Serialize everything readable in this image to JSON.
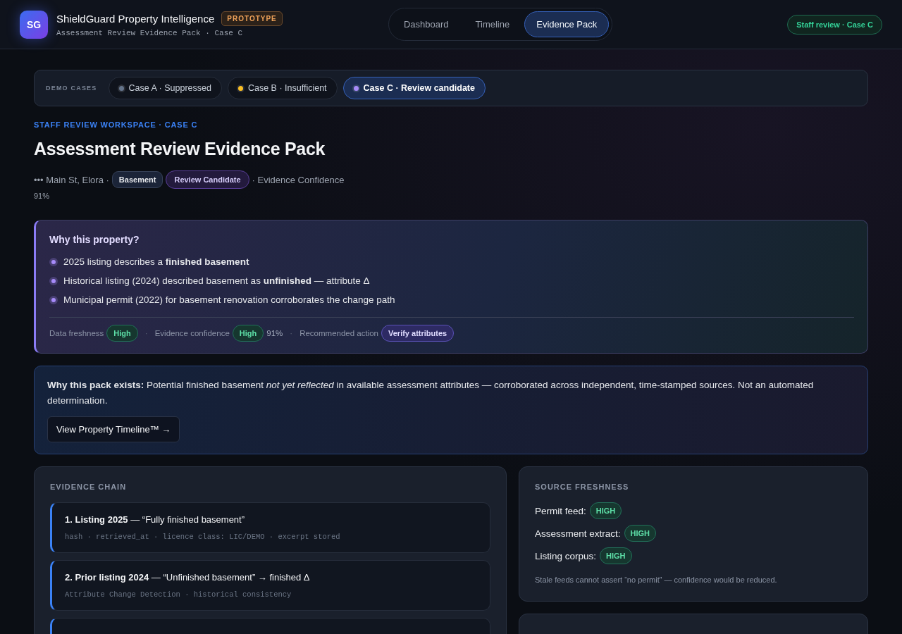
{
  "header": {
    "logo": "SG",
    "title": "ShieldGuard Property Intelligence",
    "badge": "PROTOTYPE",
    "subtitle": "Assessment Review Evidence Pack · Case C",
    "tabs": [
      {
        "label": "Dashboard",
        "selected": false
      },
      {
        "label": "Timeline",
        "selected": false
      },
      {
        "label": "Evidence Pack",
        "selected": true
      }
    ],
    "status": "Staff review · Case C"
  },
  "demo_cases": {
    "label": "DEMO CASES",
    "cases": [
      {
        "label": "Case A · Suppressed",
        "color": "#64748b",
        "selected": false
      },
      {
        "label": "Case B · Insufficient",
        "color": "#fbbf24",
        "selected": false
      },
      {
        "label": "Case C · Review candidate",
        "color": "#a78bfa",
        "selected": true
      }
    ]
  },
  "eyebrow": "STAFF REVIEW WORKSPACE · CASE C",
  "heading": "Assessment Review Evidence Pack",
  "meta": {
    "address": "••• Main St, Elora ·",
    "tags": [
      {
        "label": "Basement",
        "kind": "plain"
      },
      {
        "label": "Review Candidate",
        "kind": "purple"
      }
    ],
    "suffix": "· Evidence Confidence",
    "value": "91%"
  },
  "why_property": {
    "title": "Why this property?",
    "bullets": [
      "2025 listing describes a **finished basement**",
      "Historical listing (2024) described basement as **unfinished** — attribute Δ",
      "Municipal permit (2022) for basement renovation corroborates the change path"
    ],
    "separator": "·",
    "footer": [
      {
        "label": "Data freshness",
        "badge": "High",
        "kind": "green"
      },
      {
        "label": "Evidence confidence",
        "badge": "High",
        "kind": "green",
        "value": "91%"
      },
      {
        "label": "Recommended action",
        "badge": "Verify attributes",
        "kind": "purple"
      }
    ]
  },
  "pack": {
    "text": "**Why this pack exists:** Potential finished basement *not yet reflected* in available assessment attributes — corroborated across independent, time-stamped sources. Not an automated determination.",
    "button": "View Property Timeline™ →"
  },
  "evidence_chain": {
    "title": "EVIDENCE CHAIN",
    "items": [
      {
        "kind": "entry",
        "title": "**1. Listing 2025** — “Fully finished basement”",
        "meta": "hash · retrieved_at · licence class: LIC/DEMO · excerpt stored"
      },
      {
        "kind": "entry",
        "title": "**2. Prior listing 2024** — “Unfinished basement” → finished Δ",
        "meta": "Attribute Change Detection · historical consistency"
      },
      {
        "kind": "clipped"
      }
    ]
  },
  "source_freshness": {
    "title": "SOURCE FRESHNESS",
    "rows": [
      {
        "label": "Permit feed:",
        "badge": "HIGH"
      },
      {
        "label": "Assessment extract:",
        "badge": "HIGH"
      },
      {
        "label": "Listing corpus:",
        "badge": "HIGH"
      }
    ],
    "note": "Stale feeds cannot assert “no permit” — confidence would be reduced."
  }
}
